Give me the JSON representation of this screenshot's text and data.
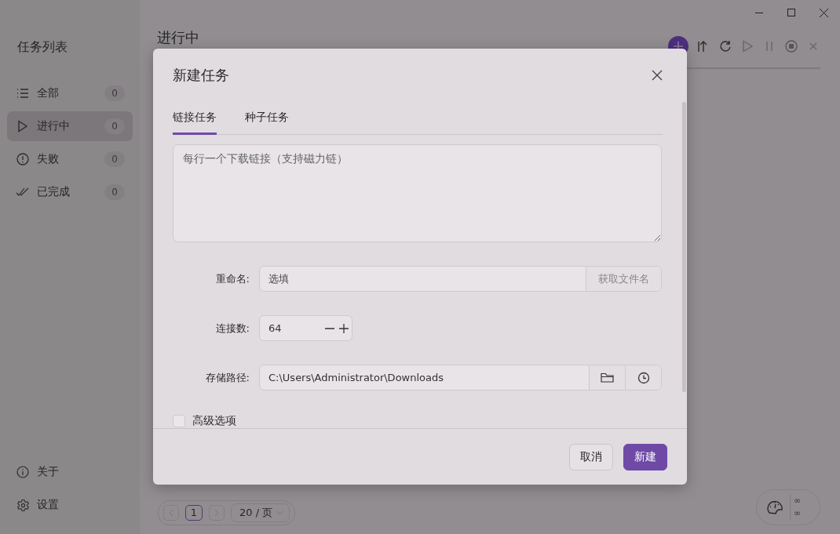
{
  "sidebar": {
    "title": "任务列表",
    "items": [
      {
        "label": "全部",
        "count": "0",
        "selected": false
      },
      {
        "label": "进行中",
        "count": "0",
        "selected": true
      },
      {
        "label": "失败",
        "count": "0",
        "selected": false
      },
      {
        "label": "已完成",
        "count": "0",
        "selected": false
      }
    ],
    "footer_items": [
      {
        "label": "关于"
      },
      {
        "label": "设置"
      }
    ]
  },
  "main": {
    "heading": "进行中",
    "pagination": {
      "page": "1",
      "page_size": "20 / 页"
    },
    "speed": {
      "upload": "∞",
      "download": "∞"
    }
  },
  "dialog": {
    "title": "新建任务",
    "tabs": [
      {
        "label": "链接任务",
        "selected": true
      },
      {
        "label": "种子任务",
        "selected": false
      }
    ],
    "links": {
      "placeholder": "每行一个下载链接（支持磁力链）"
    },
    "fields": [
      {
        "kind": "text-with-button",
        "label": "重命名:",
        "placeholder": "选填",
        "button": "获取文件名"
      },
      {
        "kind": "stepper",
        "label": "连接数:",
        "value": "64"
      },
      {
        "kind": "path",
        "label": "存储路径:",
        "value": "C:\\Users\\Administrator\\Downloads"
      }
    ],
    "advanced": {
      "label": "高级选项",
      "checked": false
    },
    "buttons": [
      {
        "label": "取消",
        "kind": "secondary"
      },
      {
        "label": "新建",
        "kind": "primary"
      }
    ]
  }
}
